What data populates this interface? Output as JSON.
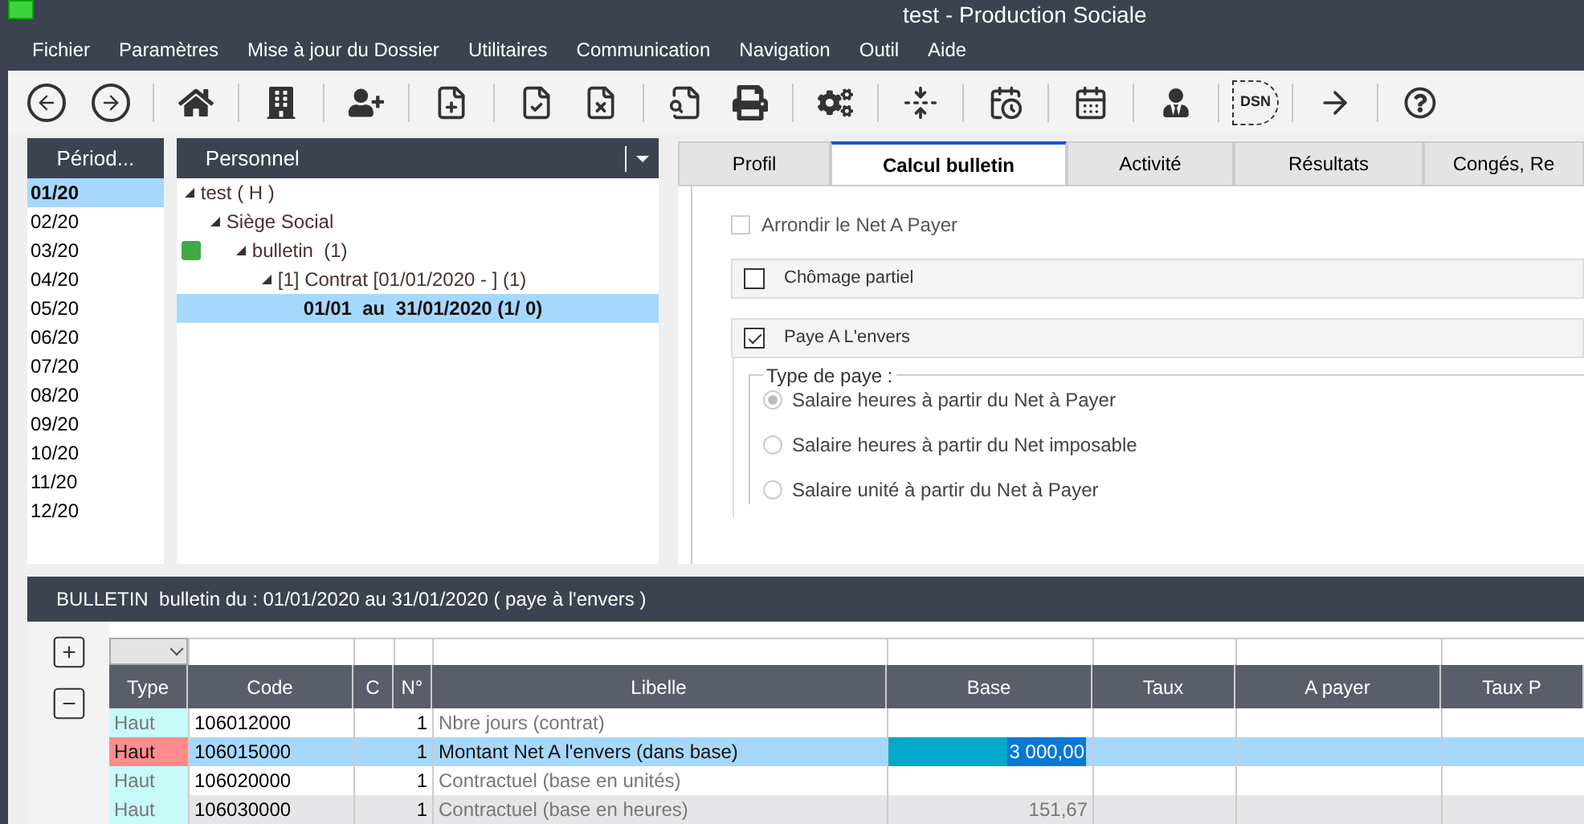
{
  "window": {
    "title": "test - Production Sociale"
  },
  "menu": [
    "Fichier",
    "Paramètres",
    "Mise à jour du Dossier",
    "Utilitaires",
    "Communication",
    "Navigation",
    "Outil",
    "Aide"
  ],
  "toolbar": {
    "dsn_label": "DSN"
  },
  "periods": {
    "header": "Périod...",
    "items": [
      {
        "label": "01/20",
        "selected": true
      },
      {
        "label": "02/20",
        "selected": false
      },
      {
        "label": "03/20",
        "selected": false
      },
      {
        "label": "04/20",
        "selected": false
      },
      {
        "label": "05/20",
        "selected": false
      },
      {
        "label": "06/20",
        "selected": false
      },
      {
        "label": "07/20",
        "selected": false
      },
      {
        "label": "08/20",
        "selected": false
      },
      {
        "label": "09/20",
        "selected": false
      },
      {
        "label": "10/20",
        "selected": false
      },
      {
        "label": "11/20",
        "selected": false
      },
      {
        "label": "12/20",
        "selected": false
      }
    ]
  },
  "personnel": {
    "header": "Personnel",
    "tree": [
      {
        "label": "test ( H )",
        "expanded": true,
        "selected": false,
        "children": [
          {
            "label": "Siège Social",
            "expanded": true,
            "selected": false,
            "children": [
              {
                "label": "bulletin  (1)",
                "expanded": true,
                "selected": false,
                "color": "#3fa945",
                "children": [
                  {
                    "label": "[1] Contrat [01/01/2020 - ] (1)",
                    "expanded": true,
                    "selected": false,
                    "children": [
                      {
                        "label": "01/01  au  31/01/2020 (1/ 0)",
                        "selected": true
                      }
                    ]
                  }
                ]
              }
            ]
          }
        ]
      }
    ]
  },
  "tabs": [
    {
      "label": "Profil",
      "selected": false
    },
    {
      "label": "Calcul bulletin",
      "selected": true
    },
    {
      "label": "Activité",
      "selected": false
    },
    {
      "label": "Résultats",
      "selected": false
    },
    {
      "label": "Congés, Re",
      "selected": false
    }
  ],
  "options": [
    {
      "kind": "check",
      "label": "Arrondir le Net A Payer",
      "checked": false
    },
    {
      "kind": "section",
      "label": "Chômage partiel",
      "checked": false
    },
    {
      "kind": "section",
      "label": "Paye A L'envers",
      "checked": true
    }
  ],
  "pay_type": {
    "legend": "Type de paye :",
    "options": [
      {
        "label": "Salaire heures à partir du Net à Payer",
        "selected": true,
        "disabled": true
      },
      {
        "label": "Salaire heures à partir du Net imposable",
        "selected": false,
        "disabled": true
      },
      {
        "label": "Salaire unité à partir du Net à Payer",
        "selected": false,
        "disabled": true
      }
    ]
  },
  "bulletin": {
    "title": "BULLETIN  bulletin du : 01/01/2020 au 31/01/2020 ( paye à l'envers )",
    "columns": [
      "Type",
      "Code",
      "C",
      "N°",
      "Libelle",
      "Base",
      "Taux",
      "A payer",
      "Taux P"
    ],
    "rows": [
      {
        "type": "Haut",
        "color": "#c8fafa",
        "code": "106012000",
        "n": "1",
        "libelle": "Nbre jours (contrat)",
        "base": "",
        "selected": false,
        "shaded": false
      },
      {
        "type": "Haut",
        "color": "#ff8c8c",
        "code": "106015000",
        "n": "1",
        "libelle": "Montant Net A l'envers (dans base)",
        "base": "3 000,00",
        "selected": true,
        "shaded": false
      },
      {
        "type": "Haut",
        "color": "#c8fafa",
        "code": "106020000",
        "n": "1",
        "libelle": "Contractuel (base en unités)",
        "base": "",
        "selected": false,
        "shaded": false
      },
      {
        "type": "Haut",
        "color": "#c8fafa",
        "code": "106030000",
        "n": "1",
        "libelle": "Contractuel (base en heures)",
        "base": "151,67",
        "selected": false,
        "shaded": true
      }
    ]
  }
}
